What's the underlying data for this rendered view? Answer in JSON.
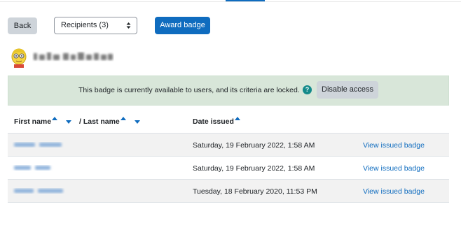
{
  "toolbar": {
    "back_label": "Back",
    "recipients_select": "Recipients (3)",
    "award_label": "Award badge"
  },
  "notice": {
    "text": "This badge is currently available to users, and its criteria are locked.",
    "help_icon": "question-circle-icon",
    "disable_label": "Disable access"
  },
  "table": {
    "columns": {
      "first_name": "First name",
      "last_name": "/ Last name",
      "date_issued": "Date issued"
    },
    "rows": [
      {
        "date": "Saturday, 19 February 2022, 1:58 AM",
        "action": "View issued badge"
      },
      {
        "date": "Saturday, 19 February 2022, 1:58 AM",
        "action": "View issued badge"
      },
      {
        "date": "Tuesday, 18 February 2020, 11:53 PM",
        "action": "View issued badge"
      }
    ]
  },
  "colors": {
    "primary": "#0f6cbf",
    "notice_bg": "#d8e6d9",
    "help_icon": "#138a8a",
    "secondary_button": "#ced4da"
  }
}
